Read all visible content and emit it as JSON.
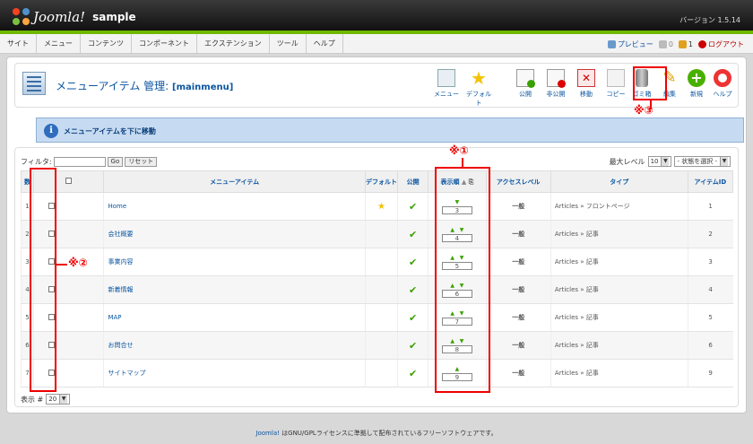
{
  "header": {
    "logo_text": "Joomla!",
    "site_name": "sample",
    "version": "バージョン 1.5.14"
  },
  "menu": {
    "items": [
      "サイト",
      "メニュー",
      "コンテンツ",
      "コンポーネント",
      "エクステンション",
      "ツール",
      "ヘルプ"
    ],
    "preview": "プレビュー",
    "messages": "0",
    "users": "1",
    "logout": "ログアウト"
  },
  "page": {
    "title": "メニューアイテム 管理:",
    "subtitle": "[mainmenu]"
  },
  "toolbar": {
    "menus": "メニュー",
    "default": "デフォルト",
    "publish": "公開",
    "unpublish": "非公開",
    "move": "移動",
    "copy": "コピー",
    "trash": "ゴミ箱",
    "edit": "編集",
    "new": "新規",
    "help": "ヘルプ"
  },
  "message": {
    "text": "メニューアイテムを下に移動"
  },
  "filter": {
    "label": "フィルタ:",
    "go": "Go",
    "reset": "リセット",
    "max_level_label": "最大レベル",
    "max_level": "10",
    "state": "- 状態を選択 -"
  },
  "table": {
    "headers": {
      "num": "数",
      "title": "メニューアイテム",
      "default": "デフォルト",
      "published": "公開",
      "order": "表示順",
      "access": "アクセスレベル",
      "type": "タイプ",
      "id": "アイテムID"
    },
    "rows": [
      {
        "num": "1",
        "title": "Home",
        "order": "3",
        "access": "一般",
        "type": "Articles » フロントページ",
        "id": "1"
      },
      {
        "num": "2",
        "title": "会社概要",
        "order": "4",
        "access": "一般",
        "type": "Articles » 記事",
        "id": "2"
      },
      {
        "num": "3",
        "title": "事業内容",
        "order": "5",
        "access": "一般",
        "type": "Articles » 記事",
        "id": "3"
      },
      {
        "num": "4",
        "title": "新着情報",
        "order": "6",
        "access": "一般",
        "type": "Articles » 記事",
        "id": "4"
      },
      {
        "num": "5",
        "title": "MAP",
        "order": "7",
        "access": "一般",
        "type": "Articles » 記事",
        "id": "5"
      },
      {
        "num": "6",
        "title": "お問合せ",
        "order": "8",
        "access": "一般",
        "type": "Articles » 記事",
        "id": "6"
      },
      {
        "num": "7",
        "title": "サイトマップ",
        "order": "9",
        "access": "一般",
        "type": "Articles » 記事",
        "id": "9"
      }
    ]
  },
  "pager": {
    "label": "表示 #",
    "value": "20"
  },
  "notes": {
    "n1": "※①",
    "n2": "※②",
    "n3": "※③"
  },
  "footer": {
    "brand": "Joomla!",
    "text": " はGNU/GPLライセンスに準拠して配布されているフリーソフトウェアです。"
  }
}
